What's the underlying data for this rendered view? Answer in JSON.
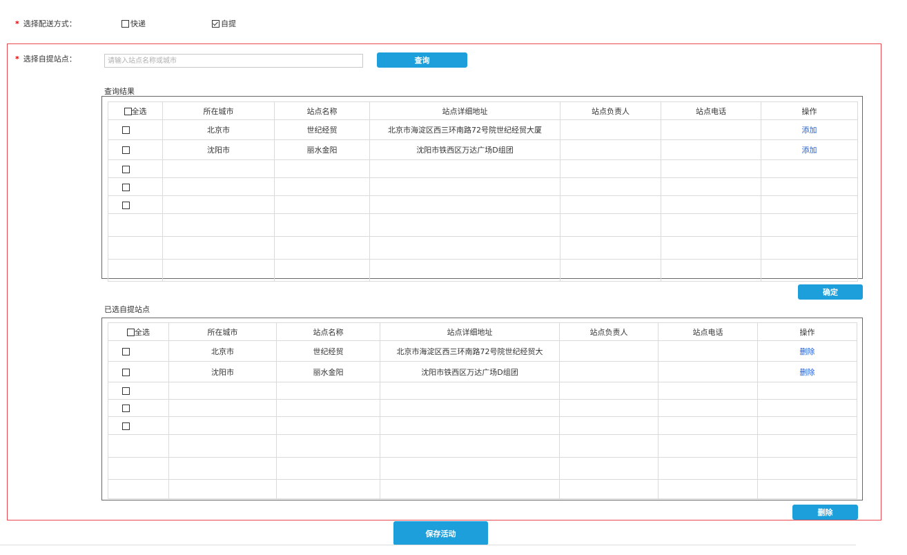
{
  "delivery": {
    "label": "选择配送方式：",
    "options": [
      {
        "label": "快递",
        "checked": false
      },
      {
        "label": "自提",
        "checked": true
      }
    ]
  },
  "pickup": {
    "label": "选择自提站点：",
    "search_placeholder": "请输入站点名称或城市",
    "search_button": "查询"
  },
  "results": {
    "title": "查询结果",
    "select_all": "全选",
    "columns": [
      "所在城市",
      "站点名称",
      "站点详细地址",
      "站点负责人",
      "站点电话",
      "操作"
    ],
    "rows": [
      {
        "city": "北京市",
        "name": "世纪经贸",
        "address": "北京市海淀区西三环南路72号院世纪经贸大厦",
        "manager": "",
        "phone": "",
        "action": "添加"
      },
      {
        "city": "沈阳市",
        "name": "丽水金阳",
        "address": "沈阳市铁西区万达广场D组团",
        "manager": "",
        "phone": "",
        "action": "添加"
      }
    ],
    "confirm_button": "确定"
  },
  "selected": {
    "title": "已选自提站点",
    "select_all": "全选",
    "columns": [
      "所在城市",
      "站点名称",
      "站点详细地址",
      "站点负责人",
      "站点电话",
      "操作"
    ],
    "rows": [
      {
        "city": "北京市",
        "name": "世纪经贸",
        "address": "北京市海淀区西三环南路72号院世纪经贸大",
        "manager": "",
        "phone": "",
        "action": "删除"
      },
      {
        "city": "沈阳市",
        "name": "丽水金阳",
        "address": "沈阳市铁西区万达广场D组团",
        "manager": "",
        "phone": "",
        "action": "删除"
      }
    ],
    "delete_button": "删除"
  },
  "save_button": "保存活动",
  "colors": {
    "accent": "#1d9fdb",
    "required": "#e00000",
    "link": "#1d5ed8",
    "frame": "#e8474b"
  }
}
